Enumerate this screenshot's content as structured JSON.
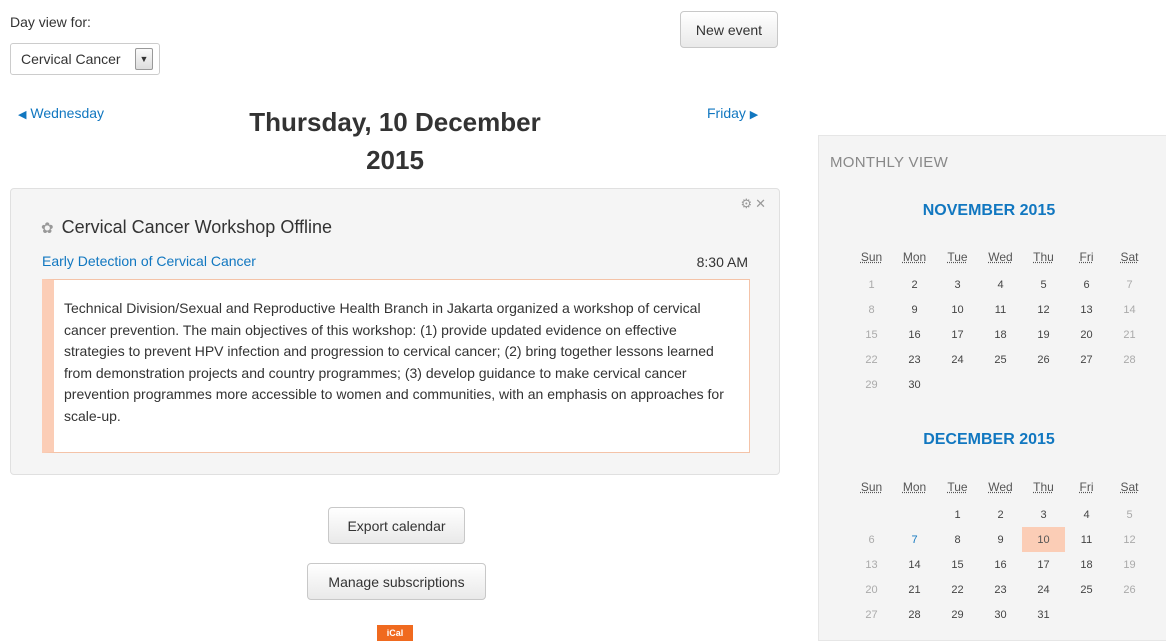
{
  "header": {
    "day_view_label": "Day view for:",
    "course_select_value": "Cervical Cancer",
    "new_event_label": "New event"
  },
  "navigation": {
    "prev_label": "Wednesday",
    "next_label": "Friday",
    "day_title_line1": "Thursday, 10 December",
    "day_title_line2": "2015"
  },
  "event": {
    "name": "Cervical Cancer Workshop Offline",
    "course": "Early Detection of Cervical Cancer",
    "time": "8:30 AM",
    "description": "Technical Division/Sexual and Reproductive Health Branch in Jakarta organized a workshop of cervical cancer prevention. The main objectives of this workshop: (1) provide updated evidence on effective strategies to prevent HPV infection and progression to cervical cancer; (2) bring together lessons learned from demonstration projects and country programmes; (3) develop guidance to make cervical cancer prevention programmes more accessible to women and communities, with an emphasis on approaches for scale-up."
  },
  "footer": {
    "export_label": "Export calendar",
    "manage_label": "Manage subscriptions",
    "ical_label": "iCal"
  },
  "sidebar": {
    "title": "MONTHLY VIEW",
    "weekdays": [
      "Sun",
      "Mon",
      "Tue",
      "Wed",
      "Thu",
      "Fri",
      "Sat"
    ],
    "months": [
      {
        "title": "NOVEMBER 2015",
        "weeks": [
          [
            "1",
            "2",
            "3",
            "4",
            "5",
            "6",
            "7"
          ],
          [
            "8",
            "9",
            "10",
            "11",
            "12",
            "13",
            "14"
          ],
          [
            "15",
            "16",
            "17",
            "18",
            "19",
            "20",
            "21"
          ],
          [
            "22",
            "23",
            "24",
            "25",
            "26",
            "27",
            "28"
          ],
          [
            "29",
            "30",
            "",
            "",
            "",
            "",
            ""
          ]
        ]
      },
      {
        "title": "DECEMBER 2015",
        "weeks": [
          [
            "",
            "",
            "1",
            "2",
            "3",
            "4",
            "5"
          ],
          [
            "6",
            "7",
            "8",
            "9",
            "10",
            "11",
            "12"
          ],
          [
            "13",
            "14",
            "15",
            "16",
            "17",
            "18",
            "19"
          ],
          [
            "20",
            "21",
            "22",
            "23",
            "24",
            "25",
            "26"
          ],
          [
            "27",
            "28",
            "29",
            "30",
            "31",
            "",
            ""
          ]
        ],
        "today": "10",
        "event_days": [
          "7"
        ]
      }
    ]
  },
  "colors": {
    "link": "#1177c0",
    "today_highlight": "#fbcdb6",
    "ical_badge": "#f06a1f"
  }
}
